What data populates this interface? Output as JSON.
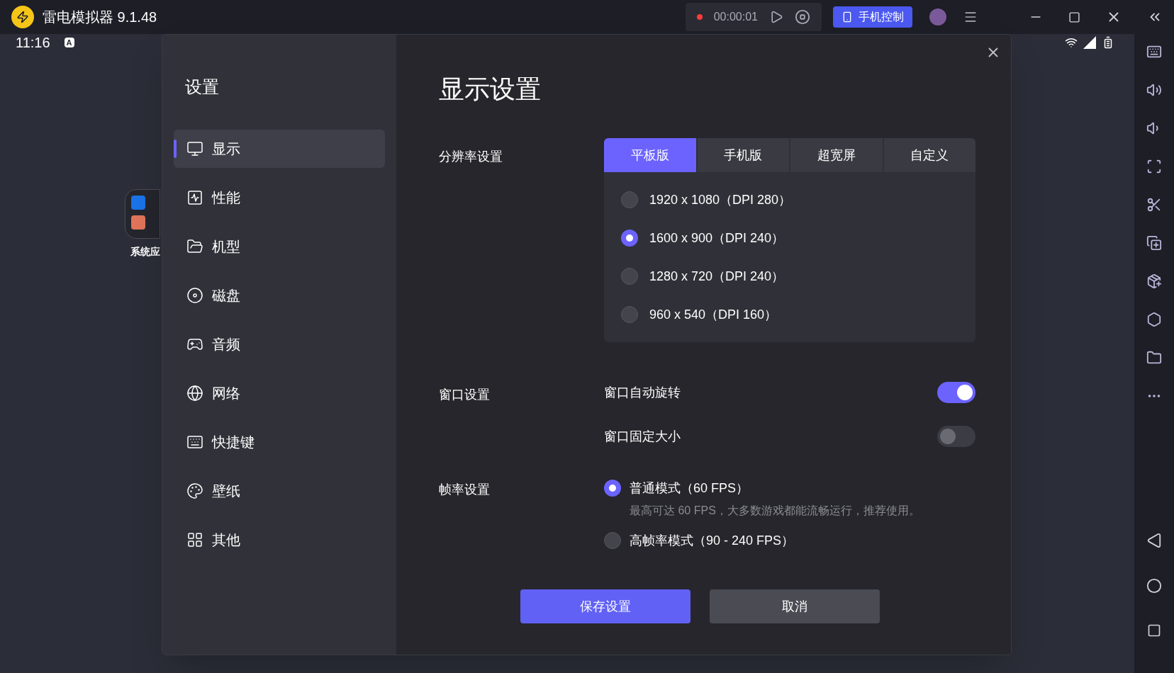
{
  "app_bar": {
    "title": "雷电模拟器 9.1.48",
    "recording_time": "00:00:01",
    "phone_control_button": "手机控制"
  },
  "status_bar": {
    "time": "11:16",
    "input_indicator": "A"
  },
  "desktop": {
    "folder_label": "系统应"
  },
  "settings": {
    "title": "设置",
    "nav": [
      {
        "label": "显示",
        "selected": true
      },
      {
        "label": "性能",
        "selected": false
      },
      {
        "label": "机型",
        "selected": false
      },
      {
        "label": "磁盘",
        "selected": false
      },
      {
        "label": "音频",
        "selected": false
      },
      {
        "label": "网络",
        "selected": false
      },
      {
        "label": "快捷键",
        "selected": false
      },
      {
        "label": "壁纸",
        "selected": false
      },
      {
        "label": "其他",
        "selected": false
      }
    ]
  },
  "display": {
    "title": "显示设置",
    "resolution": {
      "label": "分辨率设置",
      "tabs": [
        {
          "label": "平板版",
          "selected": true
        },
        {
          "label": "手机版",
          "selected": false
        },
        {
          "label": "超宽屏",
          "selected": false
        },
        {
          "label": "自定义",
          "selected": false
        }
      ],
      "options": [
        {
          "label": "1920 x 1080（DPI 280）",
          "selected": false
        },
        {
          "label": "1600 x 900（DPI 240）",
          "selected": true
        },
        {
          "label": "1280 x 720（DPI 240）",
          "selected": false
        },
        {
          "label": "960 x 540（DPI 160）",
          "selected": false
        }
      ]
    },
    "window": {
      "label": "窗口设置",
      "toggles": [
        {
          "label": "窗口自动旋转",
          "on": true
        },
        {
          "label": "窗口固定大小",
          "on": false
        }
      ]
    },
    "frame_rate": {
      "label": "帧率设置",
      "modes": [
        {
          "label": "普通模式（60 FPS）",
          "description": "最高可达 60 FPS，大多数游戏都能流畅运行，推荐使用。",
          "selected": true
        },
        {
          "label": "高帧率模式（90 - 240 FPS）",
          "selected": false
        }
      ]
    }
  },
  "buttons": [
    {
      "label": "保存设置",
      "kind": "primary"
    },
    {
      "label": "取消",
      "kind": "secondary"
    }
  ]
}
